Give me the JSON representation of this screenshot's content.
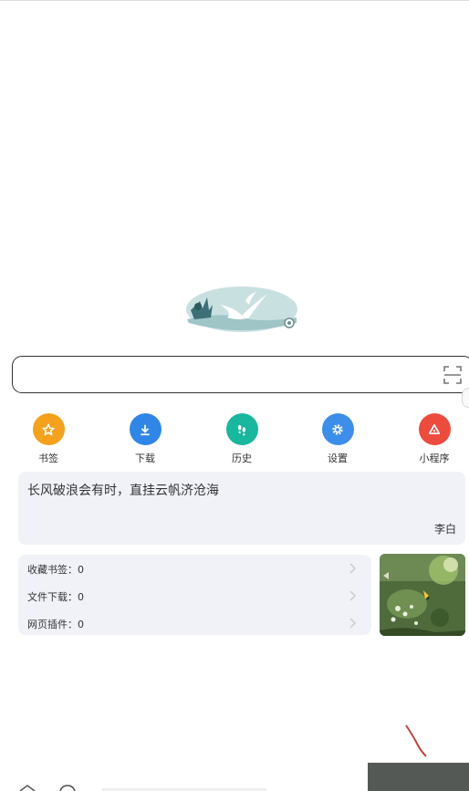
{
  "colors": {
    "bookmark": "#f4a11d",
    "download": "#2f86e6",
    "history": "#18b79e",
    "settings": "#3c8ee8",
    "miniprogram": "#ee4b3f",
    "card_background": "#f0f2f8"
  },
  "logo": {
    "icon": "seagull-logo-icon"
  },
  "search": {
    "placeholder": "",
    "scan_icon": "scan-icon"
  },
  "quick_links": [
    {
      "label": "书签",
      "icon": "star-icon"
    },
    {
      "label": "下载",
      "icon": "download-icon"
    },
    {
      "label": "历史",
      "icon": "footprints-icon"
    },
    {
      "label": "设置",
      "icon": "gear-icon"
    },
    {
      "label": "小程序",
      "icon": "miniprogram-icon"
    }
  ],
  "quote": {
    "text": "长风破浪会有时，直挂云帆济沧海",
    "author": "李白"
  },
  "stats": [
    {
      "label": "收藏书签：0"
    },
    {
      "label": "文件下载：0"
    },
    {
      "label": "网页插件：0"
    }
  ],
  "scene_image": {
    "icon": "nature-scene-image"
  }
}
